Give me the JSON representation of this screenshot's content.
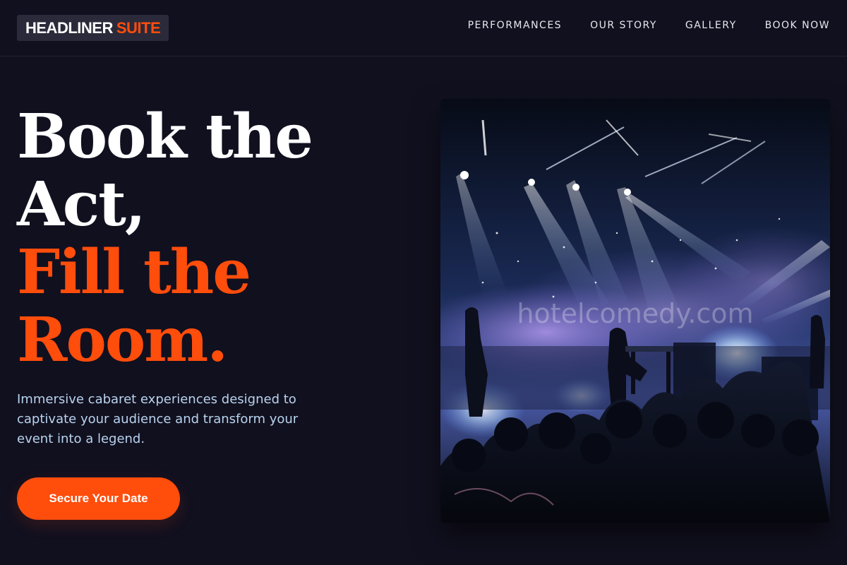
{
  "header": {
    "logo": {
      "word1": "HEADLINER",
      "word2": "SUITE"
    },
    "nav": [
      {
        "label": "PERFORMANCES"
      },
      {
        "label": "OUR STORY"
      },
      {
        "label": "GALLERY"
      },
      {
        "label": "BOOK NOW"
      }
    ]
  },
  "hero": {
    "headline_line1": "Book the",
    "headline_line2": "Act,",
    "headline_line3": "Fill the",
    "headline_line4": "Room.",
    "description": "Immersive cabaret experiences designed to captivate your audience and transform your event into a legend.",
    "cta_label": "Secure Your Date"
  },
  "photo": {
    "watermark": "hotelcomedy.com"
  },
  "colors": {
    "background": "#11101f",
    "accent": "#ff4d0c",
    "body_text": "#b9d3ee"
  }
}
